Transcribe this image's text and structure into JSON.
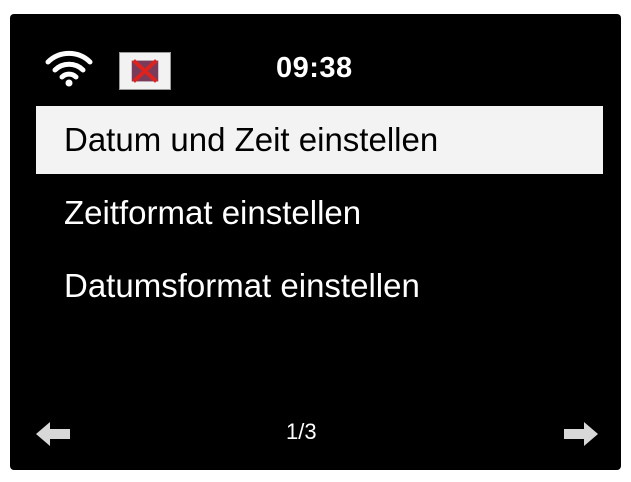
{
  "status": {
    "time": "09:38",
    "wifi_icon": "wifi-icon",
    "alarm_icon": "speaker-muted-icon"
  },
  "menu": {
    "items": [
      {
        "label": "Datum und Zeit einstellen",
        "selected": true
      },
      {
        "label": "Zeitformat einstellen",
        "selected": false
      },
      {
        "label": "Datumsformat einstellen",
        "selected": false
      }
    ]
  },
  "pager": {
    "indicator": "1/3",
    "prev_icon": "arrow-left-icon",
    "next_icon": "arrow-right-icon"
  },
  "colors": {
    "background": "#000000",
    "selection": "#f3f3f3",
    "text": "#ffffff"
  }
}
